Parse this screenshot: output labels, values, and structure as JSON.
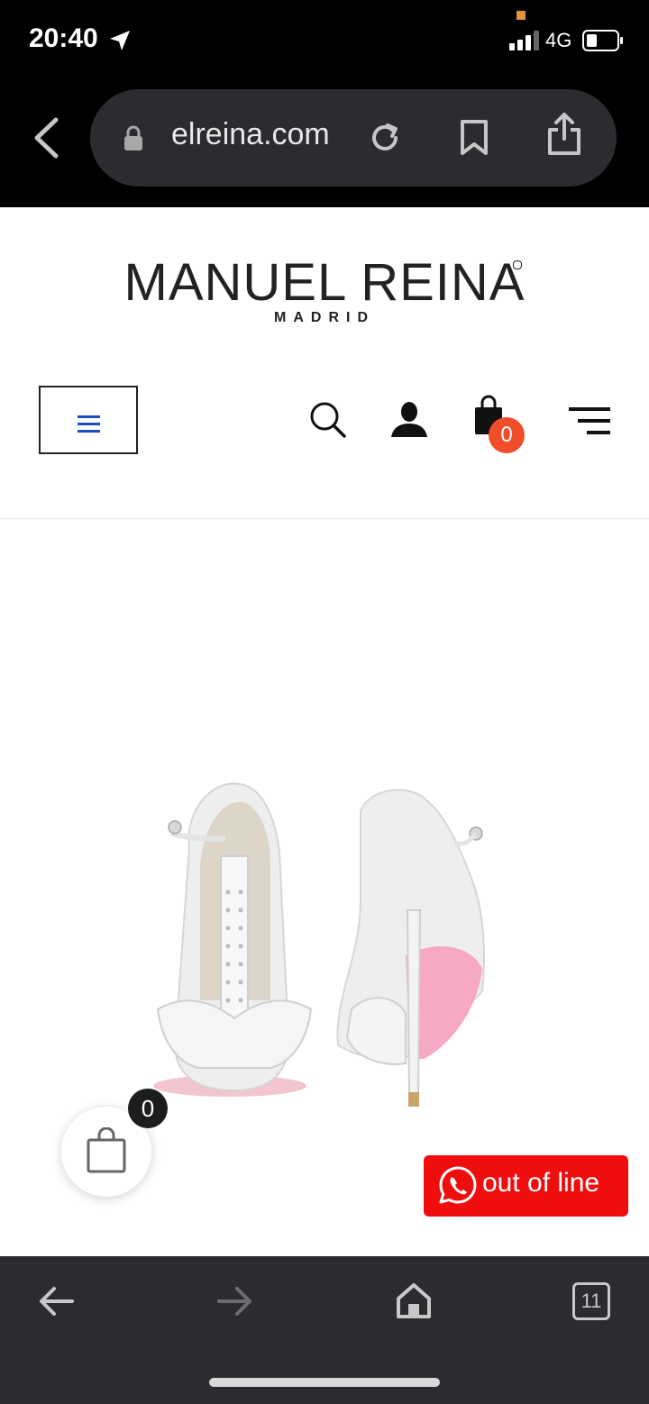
{
  "status_bar": {
    "time": "20:40",
    "network": "4G"
  },
  "browser": {
    "url": "elreina.com",
    "tabs_count": "11"
  },
  "header": {
    "brand": "MANUEL REINA",
    "brand_sub": "MADRID",
    "cart_count": "0"
  },
  "floating": {
    "cart_count": "0",
    "whatsapp_label": "out of line"
  },
  "colors": {
    "badge": "#f14d2a",
    "whatsapp": "#f00d0d",
    "menu_icon": "#1f4fbf"
  }
}
